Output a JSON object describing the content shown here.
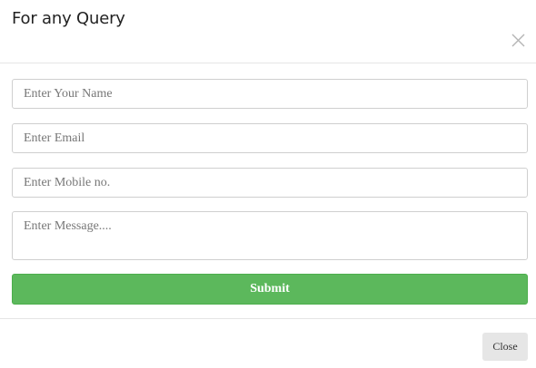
{
  "header": {
    "title": "For any Query",
    "close_icon": "close-icon"
  },
  "form": {
    "name_placeholder": "Enter Your Name",
    "email_placeholder": "Enter Email",
    "mobile_placeholder": "Enter Mobile no.",
    "message_placeholder": "Enter Message....",
    "submit_label": "Submit"
  },
  "footer": {
    "close_label": "Close"
  },
  "colors": {
    "submit_bg": "#5cb85c",
    "close_bg": "#e6e6e6"
  }
}
